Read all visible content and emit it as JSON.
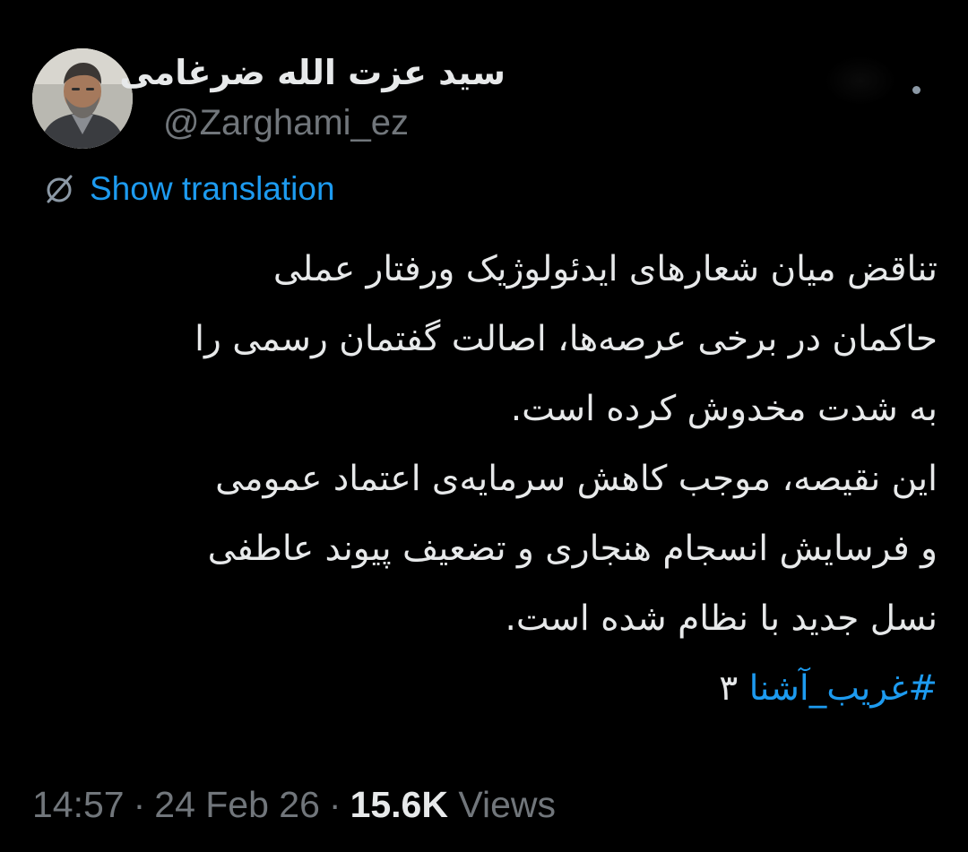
{
  "author": {
    "display_name": "سید عزت الله ضرغامی",
    "handle": "@Zarghami_ez"
  },
  "translation": {
    "icon": "globe-icon",
    "label": "Show translation"
  },
  "tweet": {
    "lines": [
      "تناقض میان شعارهای ایدئولوژیک ورفتار عملی",
      "حاکمان در برخی عرصه‌ها، اصالت گفتمان رسمی را",
      "به شدت مخدوش کرده است.",
      "این نقیصه، موجب کاهش سرمایه‌ی اعتماد عمومی",
      "و فرسایش انسجام هنجاری و تضعیف پیوند عاطفی",
      "نسل جدید با نظام شده است."
    ],
    "hashtag": "#غریب_آشنا",
    "hashtag_suffix": "۳"
  },
  "meta": {
    "time": "14:57",
    "date": "24 Feb 26",
    "views_count": "15.6K",
    "views_label": "Views",
    "separator": "·"
  },
  "colors": {
    "background": "#000000",
    "text": "#e7e9ea",
    "secondary": "#71767b",
    "accent": "#1d9bf0"
  }
}
